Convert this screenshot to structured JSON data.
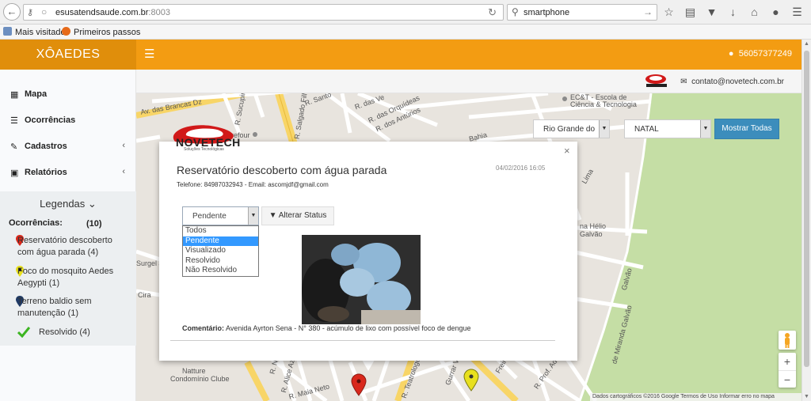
{
  "browser": {
    "url_host": "esusatendsaude.com.br",
    "url_port": ":8003",
    "search_query": "smartphone",
    "bookmarks": [
      "Mais visitados",
      "Primeiros passos"
    ]
  },
  "header": {
    "brand": "XÔAEDES",
    "user": "56057377249"
  },
  "sidebar": {
    "items": [
      {
        "label": "Mapa",
        "icon": "grid-icon"
      },
      {
        "label": "Ocorrências",
        "icon": "list-icon"
      },
      {
        "label": "Cadastros",
        "icon": "edit-icon"
      },
      {
        "label": "Relatórios",
        "icon": "file-icon"
      }
    ]
  },
  "legend": {
    "title": "Legendas",
    "subtitle": "Ocorrências:",
    "count": "(10)",
    "items": [
      {
        "label": "Reservatório descoberto com água parada (4)",
        "color": "#d9281c"
      },
      {
        "label": "Foco do mosquito Aedes Aegypti (1)",
        "color": "#e8e01e"
      },
      {
        "label": "Terreno baldio sem manutenção (1)",
        "color": "#1f3a66"
      },
      {
        "label": "Resolvido (4)",
        "color": "#3cb521"
      }
    ]
  },
  "topbar": {
    "contact": "contato@novetech.com.br"
  },
  "filters": {
    "state": "Rio Grande do",
    "city": "NATAL",
    "show_all": "Mostrar Todas"
  },
  "map": {
    "labels": [
      "Av. das Brancas Dz",
      "R. Sucupira",
      "R. Santo",
      "R. das Ve",
      "R. das Orquídeas",
      "R. dos Antúrios",
      "R. Salgado Filho",
      "EC&T - Escola de",
      "Ciência & Tecnologia",
      "Bahia",
      "Lima",
      "na Hélio",
      "Galvão",
      "Galvão",
      "de Miranda Galvão",
      "Natture",
      "Condomínio Clube",
      "R. Maia Neto",
      "R. Teatrologo",
      "Gurrar Vir",
      "Freire",
      "R. Prof. Ad",
      "R. Alice Aze",
      "R. Nata",
      "Surgel Jo",
      "Cira",
      "refour"
    ],
    "footer": "Dados cartográficos ©2016 Google   Termos de Uso   Informar erro no mapa"
  },
  "popup": {
    "logo_text": "NOVETECH",
    "logo_sub": "Soluções Tecnológicas",
    "title": "Reservatório descoberto com água parada",
    "date": "04/02/2016 16:05",
    "contact": "Telefone: 84987032943 - Email: ascomjdf@gmail.com",
    "status_selected": "Pendente",
    "status_options": [
      "Todos",
      "Pendente",
      "Visualizado",
      "Resolvido",
      "Não Resolvido"
    ],
    "change_status": "Alterar Status",
    "comment_label": "Comentário:",
    "comment": "Avenida Ayrton Sena - N° 380 - acúmulo de lixo com possível foco de dengue"
  }
}
